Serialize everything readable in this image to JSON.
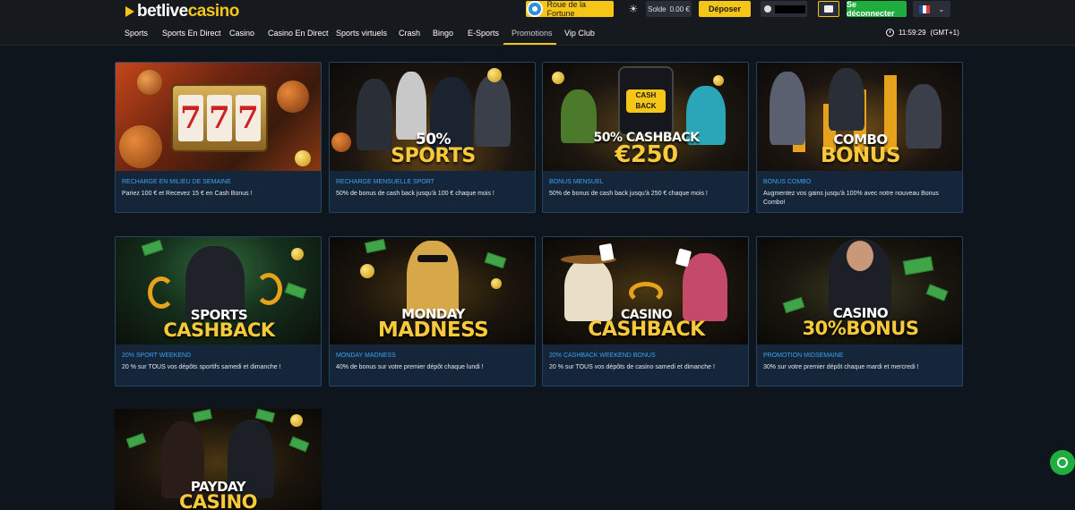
{
  "header": {
    "logo_part1": "betlive",
    "logo_part2": "casino",
    "wheel_label": "Roue de la Fortune",
    "balance_label": "Solde",
    "balance_value": "0.00 €",
    "deposit_label": "Déposer",
    "logout_label": "Se déconnecter",
    "language": "fr"
  },
  "nav": {
    "items": [
      "Sports",
      "Sports En Direct",
      "Casino",
      "Casino En Direct",
      "Sports virtuels",
      "Crash",
      "Bingo",
      "E-Sports",
      "Promotions",
      "Vip Club"
    ],
    "active": "Promotions",
    "time": "11:59:29",
    "timezone": "(GMT+1)"
  },
  "promotions": [
    {
      "line1": "",
      "line2": "",
      "title": "RECHARGE EN MILIEU DE SEMAINE",
      "desc": "Pariez 100 € et Recevez 15 € en Cash Bonus !",
      "art": "777"
    },
    {
      "line1": "50%",
      "line2": "SPORTS",
      "title": "RECHARGE MENSUELLE SPORT",
      "desc": "50% de bonus de cash back jusqu'à 100 € chaque mois !",
      "art": "sports"
    },
    {
      "line1": "50% CASHBACK",
      "line2": "€250",
      "title": "BONUS MENSUEL",
      "desc": "50% de bonus de cash back jusqu'à 250 € chaque mois !",
      "art": "cashback"
    },
    {
      "line1": "COMBO",
      "line2": "BONUS",
      "title": "BONUS COMBO",
      "desc": "Augmentez vos gains jusqu'à 100% avec notre nouveau Bonus Combo!",
      "art": "combo"
    },
    {
      "line1": "SPORTS",
      "line2": "CASHBACK",
      "title": "20% SPORT WEEKEND",
      "desc": "20 % sur TOUS vos dépôts sportifs samedi et dimanche !",
      "art": "sportscash"
    },
    {
      "line1": "MONDAY",
      "line2": "MADNESS",
      "title": "MONDAY MADNESS",
      "desc": "40% de bonus sur votre premier dépôt chaque lundi !",
      "art": "monday"
    },
    {
      "line1": "CASINO",
      "line2": "CASHBACK",
      "title": "20% CASHBACK WEEKEND BONUS",
      "desc": "20 % sur TOUS vos dépôts de casino samedi et dimanche !",
      "art": "casinocash"
    },
    {
      "line1": "CASINO",
      "line2": "30%BONUS",
      "title": "PROMOTION MIDSEMAINE",
      "desc": "30% sur votre premier dépôt chaque mardi et mercredi !",
      "art": "midweek"
    },
    {
      "line1": "PAYDAY",
      "line2": "CASINO",
      "title": "",
      "desc": "",
      "art": "payday"
    }
  ],
  "colors": {
    "accent_yellow": "#f5c518",
    "green": "#1fae3d",
    "link_blue": "#3ba3f0",
    "card_bg": "#15263a"
  }
}
